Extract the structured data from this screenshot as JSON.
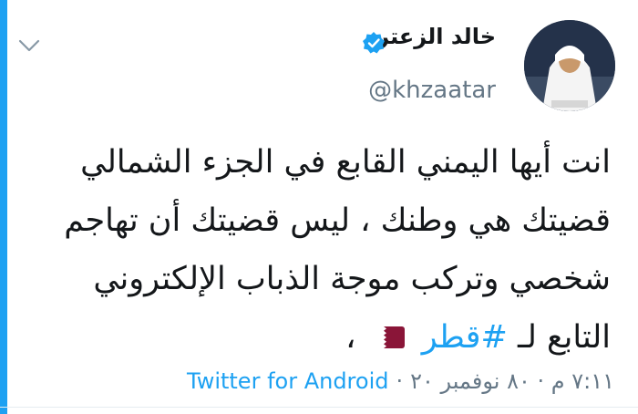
{
  "header": {
    "display_name": "خالد الزعتر",
    "handle": "@khzaatar"
  },
  "tweet": {
    "lines": [
      "انت أيها اليمني القابع في الجزء الشمالي",
      "قضيتك هي وطنك ، ليس قضيتك أن تهاجم",
      "شخصي وتركب موجة الذباب الإلكتروني"
    ],
    "last_line_prefix": "التابع لـ",
    "hashtag": "#قطر",
    "last_line_suffix": "،"
  },
  "meta": {
    "timestamp": "٧:١١ م · ٨٠ نوفمبر ٢٠",
    "separator": "·",
    "source": "Twitter for Android"
  },
  "colors": {
    "accent": "#1da1f2",
    "text": "#14171a",
    "muted": "#657786",
    "qatar_maroon": "#8a1538"
  },
  "icons": {
    "chevron": "chevron-down-icon",
    "verified": "verified-badge-icon",
    "flag": "qatar-flag-icon"
  }
}
